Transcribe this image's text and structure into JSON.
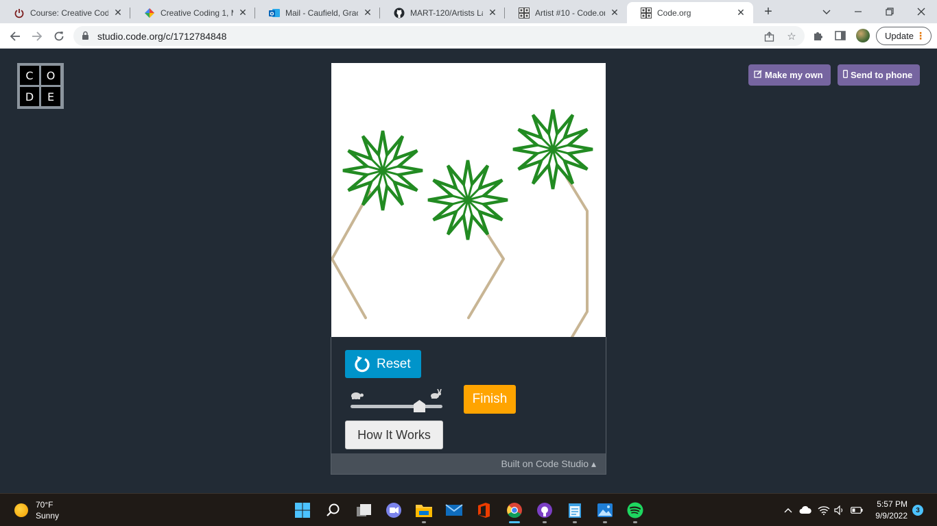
{
  "browser": {
    "tabs": [
      {
        "title": "Course: Creative Codir",
        "icon": "power-icon",
        "active": false
      },
      {
        "title": "Creative Coding 1, MA",
        "icon": "google-drive-icon",
        "active": false
      },
      {
        "title": "Mail - Caufield, Grace",
        "icon": "outlook-icon",
        "active": false
      },
      {
        "title": "MART-120/Artists Lab",
        "icon": "github-icon",
        "active": false
      },
      {
        "title": "Artist #10 - Code.org",
        "icon": "code-org-icon",
        "active": false
      },
      {
        "title": "Code.org",
        "icon": "code-org-icon",
        "active": true
      }
    ],
    "url": "studio.code.org/c/1712784848",
    "update_label": "Update"
  },
  "page": {
    "logo_letters": [
      "C",
      "O",
      "D",
      "E"
    ],
    "make_my_own_label": "Make my own",
    "send_to_phone_label": "Send to phone",
    "reset_label": "Reset",
    "finish_label": "Finish",
    "how_it_works_label": "How It Works",
    "built_on_label": "Built on Code Studio ▴",
    "speed_slider_value": 0.75,
    "colors": {
      "accent_purple": "#7665a0",
      "reset_blue": "#0094ca",
      "finish_orange": "#ffa400",
      "flower_green": "#228b22",
      "stem_tan": "#c8b594"
    }
  },
  "taskbar": {
    "weather_temp": "70°F",
    "weather_condition": "Sunny",
    "time": "5:57 PM",
    "date": "9/9/2022",
    "notification_count": "3"
  }
}
